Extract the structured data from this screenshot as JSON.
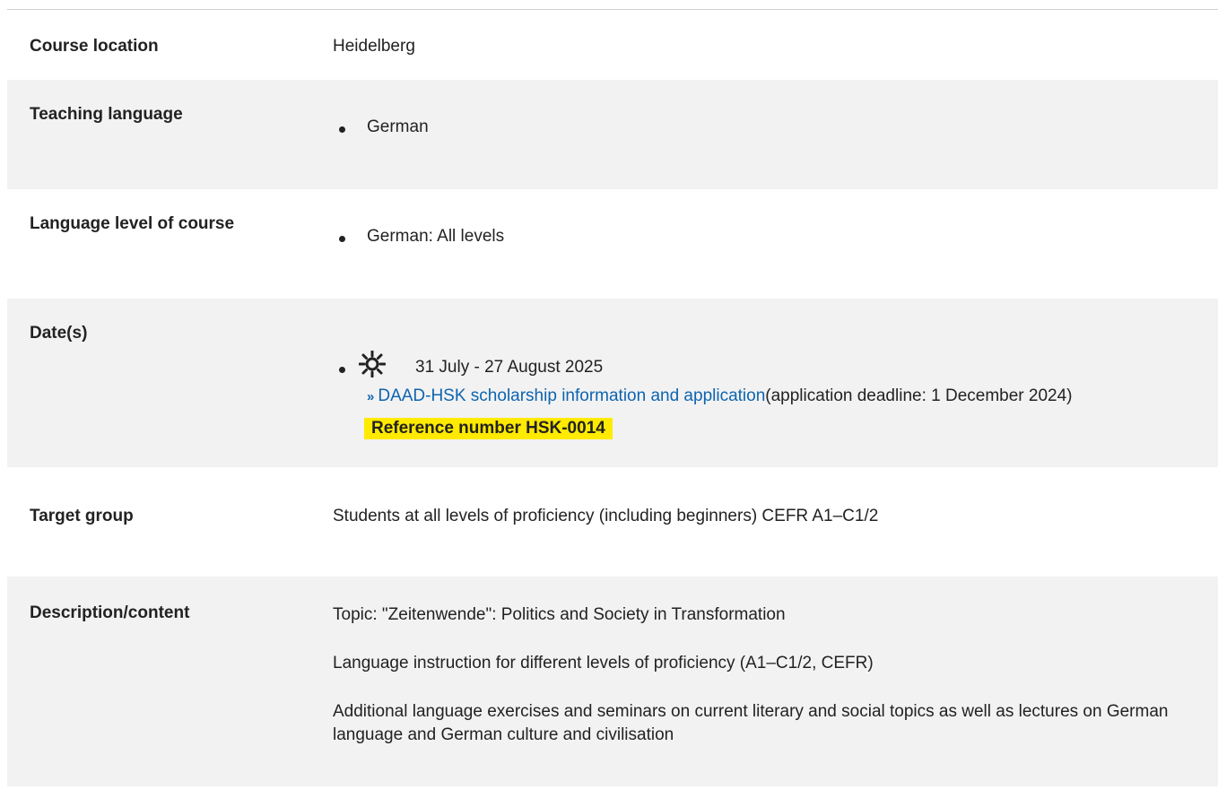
{
  "rows": {
    "course_location": {
      "label": "Course location",
      "value": "Heidelberg"
    },
    "teaching_language": {
      "label": "Teaching language",
      "items": [
        "German"
      ]
    },
    "language_level": {
      "label": "Language level of course",
      "items": [
        "German: All levels"
      ]
    },
    "dates": {
      "label": "Date(s)",
      "season_icon": "sun-icon",
      "date_range": "31 July - 27 August 2025",
      "link_text": "DAAD-HSK scholarship information and application",
      "deadline_text": "(application deadline: 1 December 2024)",
      "reference": "Reference number HSK-0014"
    },
    "target_group": {
      "label": "Target group",
      "value": "Students at all levels of proficiency (including beginners) CEFR A1–C1/2"
    },
    "description": {
      "label": "Description/content",
      "paragraphs": [
        "Topic: \"Zeitenwende\": Politics and Society in Transformation",
        "Language instruction for different levels of proficiency (A1–C1/2, CEFR)",
        "Additional language exercises and seminars on current literary and social topics as well as lectures on German language and German culture and civilisation"
      ]
    }
  },
  "colors": {
    "row_alt": "#f2f2f2",
    "link": "#0d64b0",
    "highlight": "#ffea00"
  }
}
